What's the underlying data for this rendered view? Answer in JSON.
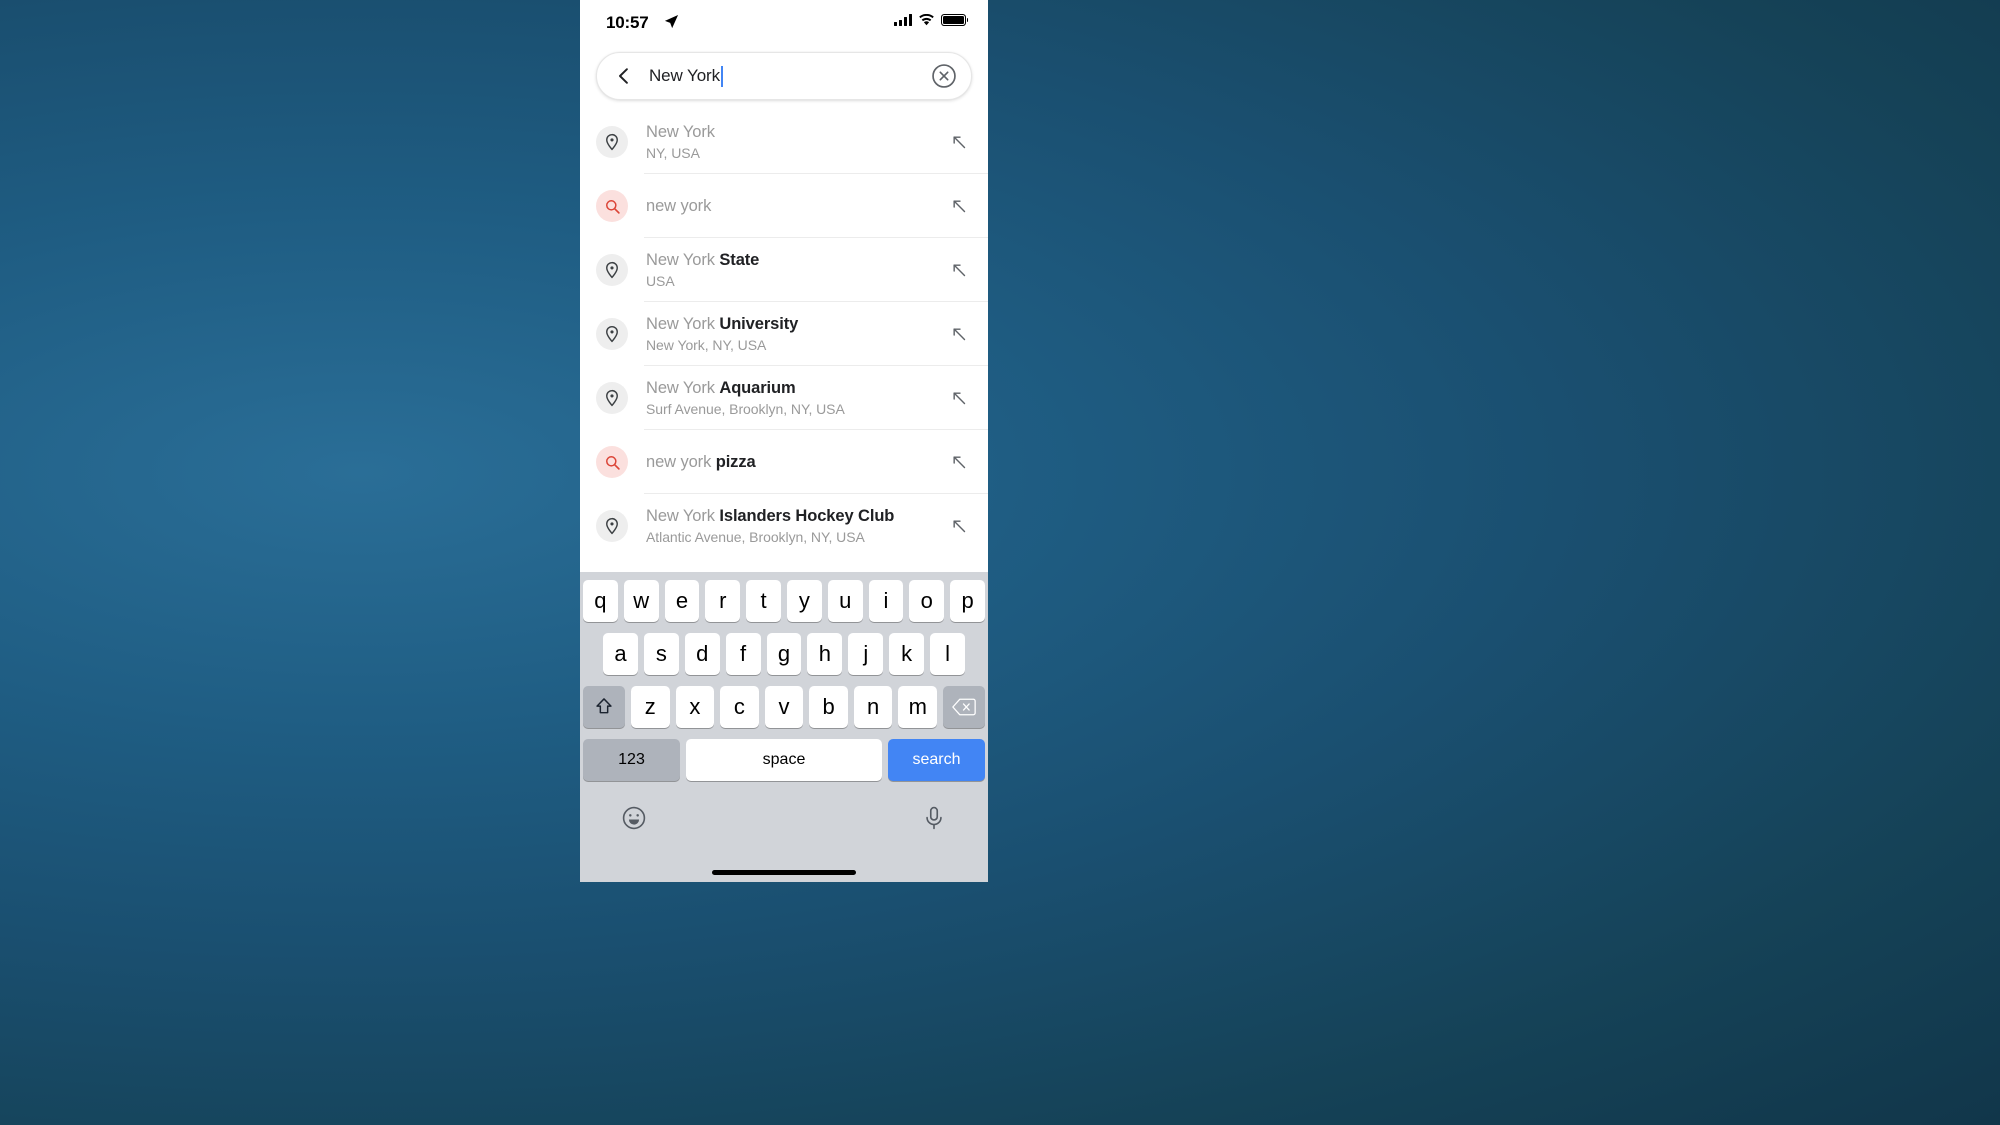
{
  "statusbar": {
    "time": "10:57",
    "location_icon": "location-arrow-icon",
    "signal_icon": "cellular-signal-icon",
    "wifi_icon": "wifi-icon",
    "battery_icon": "battery-full-icon"
  },
  "search": {
    "back_icon": "chevron-left-icon",
    "value": "New York",
    "clear_icon": "clear-circle-icon",
    "caret": true
  },
  "suggestions": [
    {
      "icon": "map-pin-icon",
      "icon_type": "place",
      "match": "New York",
      "rest": "",
      "subtitle": "NY, USA",
      "action_icon": "arrow-up-left-icon"
    },
    {
      "icon": "search-history-icon",
      "icon_type": "query",
      "match": "new york",
      "rest": "",
      "subtitle": "",
      "action_icon": "arrow-up-left-icon"
    },
    {
      "icon": "map-pin-icon",
      "icon_type": "place",
      "match": "New York ",
      "rest": "State",
      "subtitle": "USA",
      "action_icon": "arrow-up-left-icon"
    },
    {
      "icon": "map-pin-icon",
      "icon_type": "place",
      "match": "New York ",
      "rest": "University",
      "subtitle": "New York, NY, USA",
      "action_icon": "arrow-up-left-icon"
    },
    {
      "icon": "map-pin-icon",
      "icon_type": "place",
      "match": "New York ",
      "rest": "Aquarium",
      "subtitle": "Surf Avenue, Brooklyn, NY, USA",
      "action_icon": "arrow-up-left-icon"
    },
    {
      "icon": "search-history-icon",
      "icon_type": "query",
      "match": "new york ",
      "rest": "pizza",
      "subtitle": "",
      "action_icon": "arrow-up-left-icon"
    },
    {
      "icon": "map-pin-icon",
      "icon_type": "place",
      "match": "New York ",
      "rest": "Islanders Hockey Club",
      "subtitle": "Atlantic Avenue, Brooklyn, NY, USA",
      "action_icon": "arrow-up-left-icon"
    }
  ],
  "keyboard": {
    "row1": [
      "q",
      "w",
      "e",
      "r",
      "t",
      "y",
      "u",
      "i",
      "o",
      "p"
    ],
    "row2": [
      "a",
      "s",
      "d",
      "f",
      "g",
      "h",
      "j",
      "k",
      "l"
    ],
    "row3": [
      "z",
      "x",
      "c",
      "v",
      "b",
      "n",
      "m"
    ],
    "shift_icon": "shift-arrow-icon",
    "delete_icon": "backspace-icon",
    "numbers_label": "123",
    "space_label": "space",
    "search_label": "search",
    "emoji_icon": "emoji-smiley-icon",
    "mic_icon": "microphone-icon"
  },
  "colors": {
    "accent": "#4285F4",
    "query_icon": "#DB4437",
    "keyboard_bg": "#d1d4d9",
    "desktop": "#1f5d83"
  }
}
